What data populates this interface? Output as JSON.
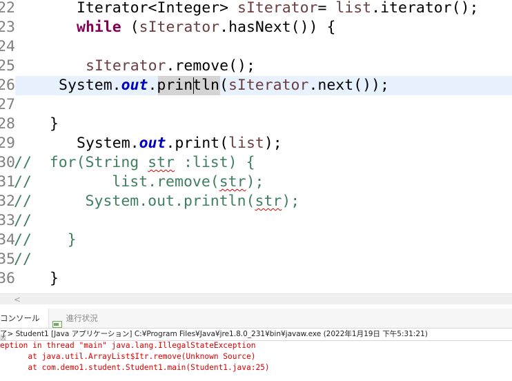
{
  "editor": {
    "line_numbers": [
      "22",
      "23",
      "24",
      "25",
      "26",
      "27",
      "28",
      "29",
      "30",
      "31",
      "32",
      "33",
      "34",
      "35",
      "36"
    ],
    "line22": {
      "p1": "Iterator<Integer> ",
      "var": "sIterator",
      "p2": "= ",
      "var2": "list",
      "p3": ".iterator();"
    },
    "line23": {
      "kw": "while",
      "p1": " (",
      "var": "sIterator",
      "p2": ".hasNext()) {"
    },
    "line25": {
      "var": "sIterator",
      "p1": ".remove();"
    },
    "line26": {
      "p1": "System.",
      "fld": "out",
      "p2": ".println(",
      "var": "sIterator",
      "p3": ".next());"
    },
    "line28": "}",
    "line29": {
      "p1": "System.",
      "fld": "out",
      "p2": ".print(",
      "var": "list",
      "p3": ");"
    },
    "line30": {
      "c1": "//  for(String ",
      "sq": "str",
      "c2": " :list) {"
    },
    "line31": {
      "c1": "//         list.remove(",
      "sq": "str",
      "c2": ");"
    },
    "line32": {
      "c1": "//      System.out.println(",
      "sq": "str",
      "c2": ");"
    },
    "line33": "//",
    "line34": "//    }",
    "line35": "//",
    "line36": "}"
  },
  "scrollbar": {
    "left_arrow": "<"
  },
  "console": {
    "tab_console": "コンソール",
    "tab_console_close": "☒",
    "tab_progress": "進行状況",
    "status": "了> Student1 [Java アプリケーション] C:¥Program Files¥Java¥jre1.8.0_231¥bin¥javaw.exe (2022年1月19日 下午5:31:21)",
    "errors": [
      "eption in thread \"main\" java.lang.IllegalStateException",
      "      at java.util.ArrayList$Itr.remove(Unknown Source)",
      "      at com.demo1.student.Student1.main(Student1.java:25)"
    ]
  }
}
